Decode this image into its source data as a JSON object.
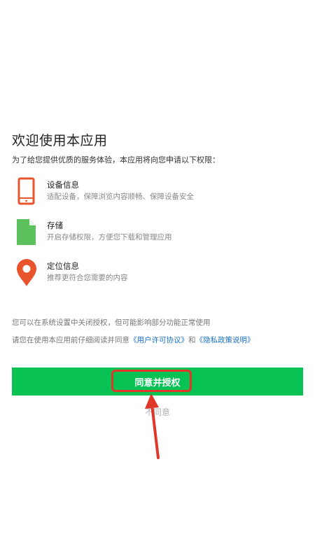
{
  "header": {
    "title": "欢迎使用本应用",
    "intro": "为了给您提供优质的服务体验，本应用将向您申请以下权限："
  },
  "permissions": [
    {
      "title": "设备信息",
      "description": "适配设备，保障浏览内容顺畅、保障设备安全",
      "icon": "phone-icon",
      "color": "#e8542c"
    },
    {
      "title": "存储",
      "description": "开启存储权限，方便您下载和管理应用",
      "icon": "file-icon",
      "color": "#5cc15c"
    },
    {
      "title": "定位信息",
      "description": "推荐更符合您需要的内容",
      "icon": "location-pin-icon",
      "color": "#e8542c"
    }
  ],
  "notes": {
    "line1": "您可以在系统设置中关闭授权，但可能影响部分功能正常使用",
    "line2_prefix": "请您在使用本应用前仔细阅读并同意",
    "user_agreement": "《用户许可协议》",
    "and": "和",
    "privacy_policy": "《隐私政策说明》"
  },
  "buttons": {
    "agree_label": "同意并授权",
    "disagree_label": "不同意"
  },
  "colors": {
    "accent_green": "#08c253",
    "annotation_red": "#e0372b",
    "link_blue": "#1a73c8"
  }
}
